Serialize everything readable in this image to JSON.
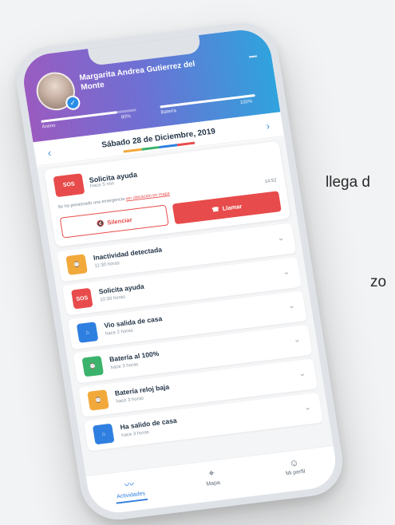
{
  "background_text": {
    "line1": "llega d",
    "line2": "zo"
  },
  "header": {
    "user_name": "Margarita Andrea Gutierrez del Monte",
    "bar1_label": "Ánimo",
    "bar1_value": "80%",
    "bar1_level": 0.8,
    "bar2_label": "Batería",
    "bar2_value": "100%",
    "bar2_level": 1.0
  },
  "date_nav": {
    "prev": "‹",
    "date": "Sábado 28 de Diciembre, 2019",
    "next": "›"
  },
  "alert": {
    "icon_text": "SOS",
    "title": "Solicita ayuda",
    "time": "Hace 5 min",
    "message_prefix": "Se ha presionado una emergencia ",
    "message_link": "ver ubicación en mapa",
    "hour": "14:52",
    "silence_label": "Silenciar",
    "call_label": "Llamar"
  },
  "activities": [
    {
      "title": "Inactividad detectada",
      "subtitle": "11:30 horas",
      "icon": "watch-icon",
      "icon_text": "⌚",
      "color": "#f2a93b"
    },
    {
      "title": "Solicita ayuda",
      "subtitle": "10:30 horas",
      "icon": "sos-icon",
      "icon_text": "SOS",
      "color": "#e84b4b"
    },
    {
      "title": "Vio salida de casa",
      "subtitle": "hace 2 horas",
      "icon": "home-icon",
      "icon_text": "⌂",
      "color": "#2f7fe0"
    },
    {
      "title": "Batería al 100%",
      "subtitle": "hace 3 horas",
      "icon": "battery-icon",
      "icon_text": "⌚",
      "color": "#3bb36c"
    },
    {
      "title": "Batería reloj baja",
      "subtitle": "hace 3 horas",
      "icon": "watch-icon",
      "icon_text": "⌚",
      "color": "#f2a93b"
    },
    {
      "title": "Ha salido de casa",
      "subtitle": "hace 3 horas",
      "icon": "home-icon",
      "icon_text": "⌂",
      "color": "#2f7fe0"
    }
  ],
  "tabs": [
    {
      "label": "Actividades",
      "icon": "activity-icon",
      "glyph": "〰",
      "active": true
    },
    {
      "label": "Mapa",
      "icon": "map-pin-icon",
      "glyph": "⌖",
      "active": false
    },
    {
      "label": "Mi perfil",
      "icon": "user-icon",
      "glyph": "☺",
      "active": false
    }
  ],
  "colors": {
    "accent": "#2f7fe0",
    "danger": "#e84b4b",
    "warning": "#f2a93b",
    "success": "#3bb36c",
    "header_start": "#9a5bc0",
    "header_end": "#2fa3dd"
  }
}
